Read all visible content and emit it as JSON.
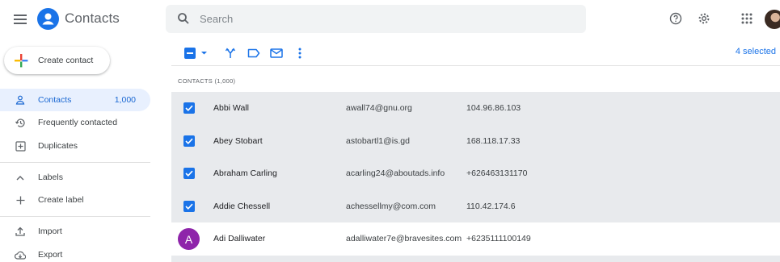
{
  "app": {
    "title": "Contacts"
  },
  "search": {
    "placeholder": "Search",
    "value": ""
  },
  "icons": {
    "menu": "hamburger-icon",
    "logo": "person-circle-icon",
    "search": "search-icon",
    "help": "help-icon",
    "settings": "gear-icon",
    "apps": "apps-grid-icon"
  },
  "colors": {
    "accent": "#1a73e8",
    "selected_row": "#e8eaed",
    "active_nav": "#e8f0fe",
    "avatar_purple": "#8e24aa"
  },
  "sidebar": {
    "create_label": "Create contact",
    "items": [
      {
        "label": "Contacts",
        "count": "1,000",
        "icon": "person-icon",
        "active": true
      },
      {
        "label": "Frequently contacted",
        "icon": "history-icon"
      },
      {
        "label": "Duplicates",
        "icon": "duplicates-icon"
      },
      {
        "label": "Labels",
        "icon": "chevron-up-icon"
      },
      {
        "label": "Create label",
        "icon": "plus-icon"
      },
      {
        "label": "Import",
        "icon": "upload-icon"
      },
      {
        "label": "Export",
        "icon": "cloud-download-icon"
      }
    ]
  },
  "toolbar": {
    "selected_text": "4 selected",
    "actions": [
      "select-all-checkbox",
      "merge-icon",
      "label-icon",
      "email-icon",
      "more-vert-icon"
    ]
  },
  "list": {
    "section_header": "CONTACTS (1,000)",
    "rows": [
      {
        "name": "Abbi Wall",
        "email": "awall74@gnu.org",
        "phone": "104.96.86.103",
        "selected": true
      },
      {
        "name": "Abey Stobart",
        "email": "astobartl1@is.gd",
        "phone": "168.118.17.33",
        "selected": true
      },
      {
        "name": "Abraham Carling",
        "email": "acarling24@aboutads.info",
        "phone": "+626463131170",
        "selected": true
      },
      {
        "name": "Addie Chessell",
        "email": "achessellmy@com.com",
        "phone": "110.42.174.6",
        "selected": true
      },
      {
        "name": "Adi Dalliwater",
        "email": "adalliwater7e@bravesites.com",
        "phone": "+6235111100149",
        "selected": false,
        "initial": "A"
      }
    ]
  }
}
